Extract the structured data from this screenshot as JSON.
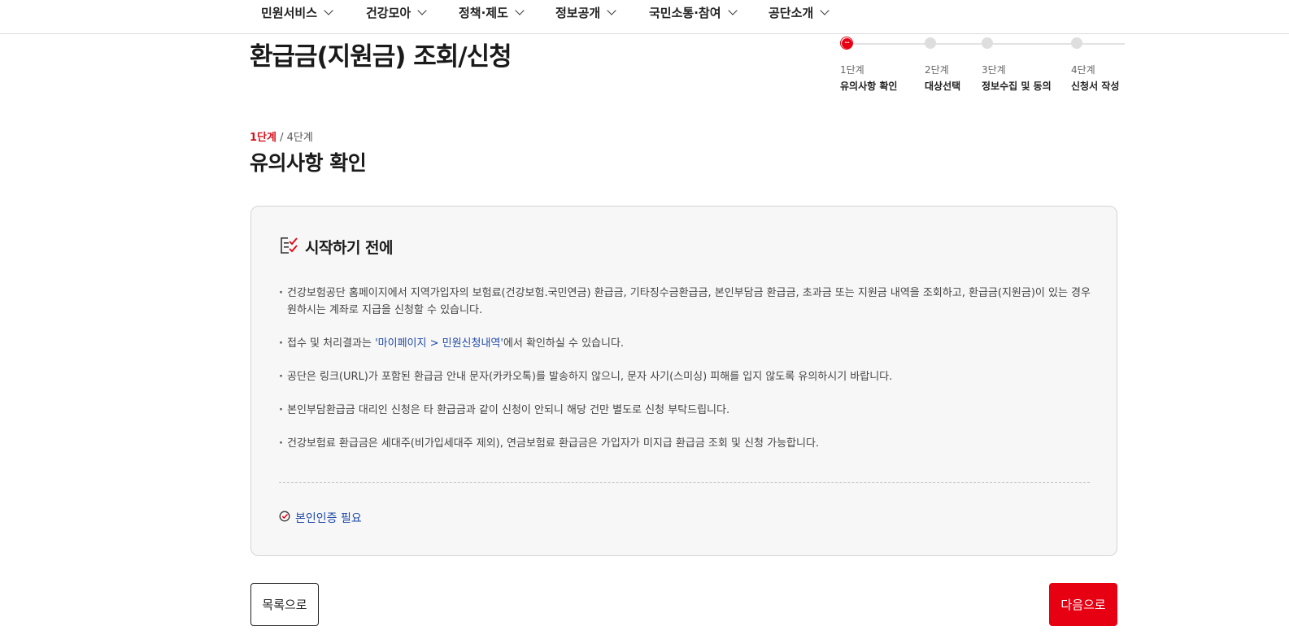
{
  "nav": {
    "menus": [
      "민원서비스",
      "건강모아",
      "정책·제도",
      "정보공개",
      "국민소통·참여",
      "공단소개"
    ]
  },
  "page": {
    "title": "환급금(지원금) 조회/신청"
  },
  "stepper": {
    "steps": [
      {
        "num": "1단계",
        "label": "유의사항 확인",
        "active": true
      },
      {
        "num": "2단계",
        "label": "대상선택",
        "active": false
      },
      {
        "num": "3단계",
        "label": "정보수집 및 동의",
        "active": false
      },
      {
        "num": "4단계",
        "label": "신청서 작성",
        "active": false
      }
    ]
  },
  "progress": {
    "current": "1단계",
    "separator": " / ",
    "total": "4단계"
  },
  "section": {
    "title": "유의사항 확인"
  },
  "notice": {
    "icon": "checklist-icon",
    "title": "시작하기 전에",
    "items": {
      "item1": "건강보험공단 홈페이지에서 지역가입자의 보험료(건강보험.국민연금) 환급금, 기타징수금환급금, 본인부담금 환급금, 초과금 또는 지원금 내역을 조회하고, 환급금(지원금)이 있는 경우 원하시는 계좌로 지급을 신청할 수 있습니다.",
      "item2_prefix": "접수 및 처리결과는 ",
      "item2_link": "'마이페이지 > 민원신청내역'",
      "item2_suffix": "에서 확인하실 수 있습니다.",
      "item3": "공단은 링크(URL)가 포함된 환급금 안내 문자(카카오톡)를 발송하지 않으니, 문자 사기(스미싱) 피해를 입지 않도록 유의하시기 바랍니다.",
      "item4": "본인부담환급금 대리인 신청은 타 환급금과 같이 신청이 안되니 해당 건만 별도로 신청 부탁드립니다.",
      "item5": "건강보험료 환급금은 세대주(비가입세대주 제외), 연금보험료 환급금은 가입자가 미지급 환급금 조회 및 신청 가능합니다."
    },
    "auth_label": "본인인증 필요"
  },
  "buttons": {
    "list": "목록으로",
    "next": "다음으로"
  },
  "colors": {
    "accent": "#e60012",
    "link": "#1f4aa8",
    "box_bg": "#f7f7f7"
  }
}
